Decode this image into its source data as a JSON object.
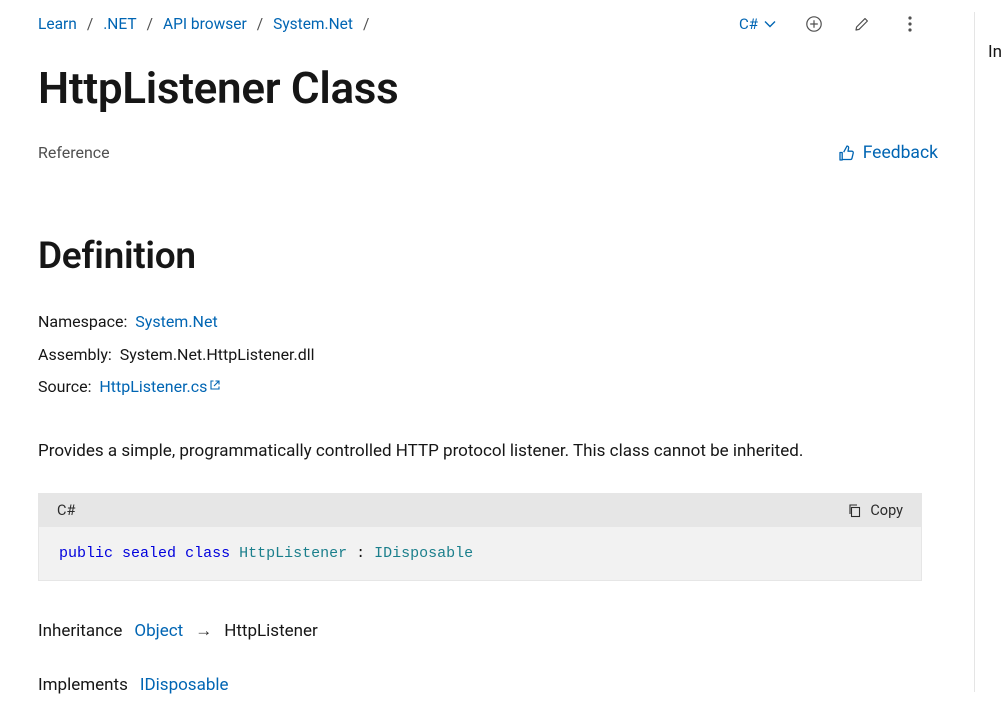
{
  "breadcrumb": {
    "items": [
      "Learn",
      ".NET",
      "API browser",
      "System.Net"
    ],
    "sep": "/"
  },
  "actions": {
    "language": "C#",
    "feedback": "Feedback"
  },
  "title": "HttpListener Class",
  "reference": "Reference",
  "definition": {
    "heading": "Definition",
    "namespace_label": "Namespace:",
    "namespace_value": "System.Net",
    "assembly_label": "Assembly:",
    "assembly_value": "System.Net.HttpListener.dll",
    "source_label": "Source:",
    "source_value": "HttpListener.cs"
  },
  "description": "Provides a simple, programmatically controlled HTTP protocol listener. This class cannot be inherited.",
  "code": {
    "lang": "C#",
    "copy": "Copy",
    "kw1": "public",
    "kw2": "sealed",
    "kw3": "class",
    "type": "HttpListener",
    "sep": " : ",
    "iface": "IDisposable"
  },
  "inheritance": {
    "label": "Inheritance",
    "base": "Object",
    "arrow": "→",
    "self": "HttpListener"
  },
  "implements": {
    "label": "Implements",
    "iface": "IDisposable"
  },
  "right_panel": {
    "text": "In"
  }
}
